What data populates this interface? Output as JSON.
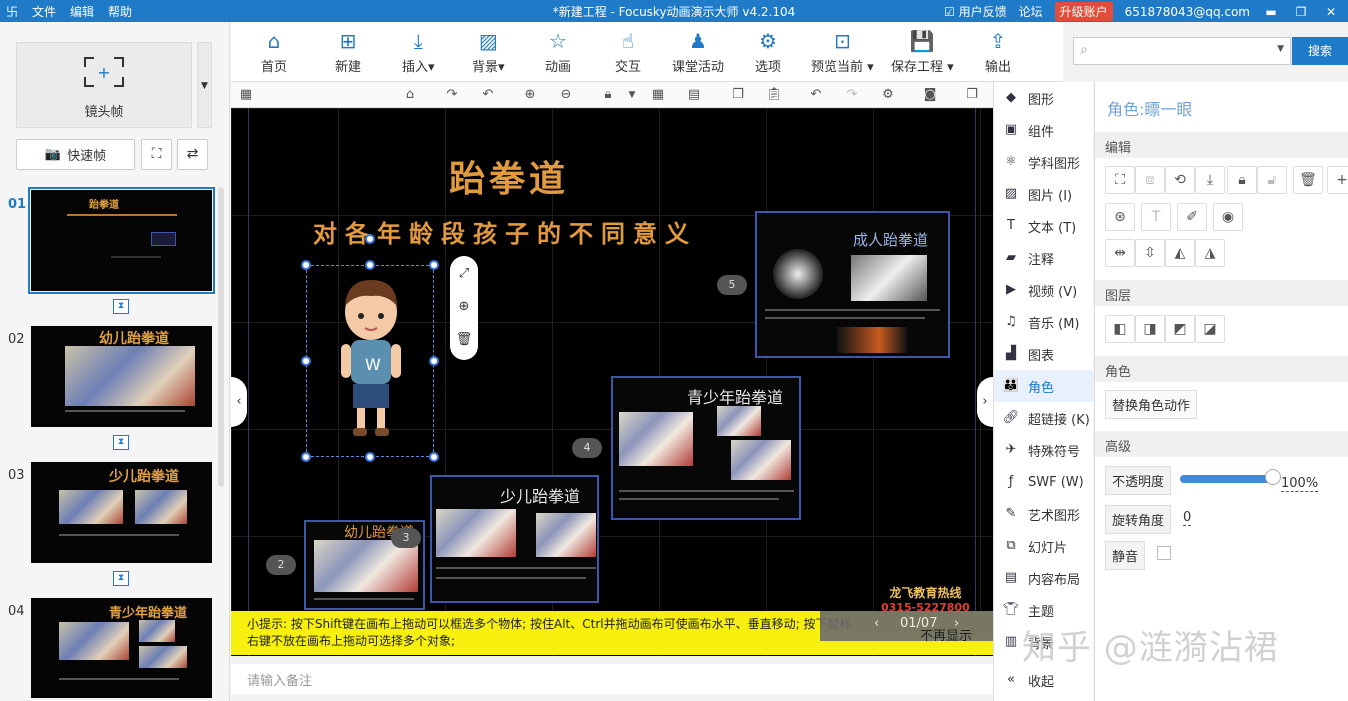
{
  "titlebar": {
    "menu": [
      "文件",
      "编辑",
      "帮助"
    ],
    "title": "*新建工程 - Focusky动画演示大师  v4.2.104",
    "feedback": "用户反馈",
    "forum": "论坛",
    "upgrade": "升级账户",
    "account": "651878043@qq.com",
    "brand_color": "#1f7ac7"
  },
  "left": {
    "camera_frame": "镜头帧",
    "snapshot": "快速帧",
    "slides": [
      {
        "num": "01",
        "title": "跆拳道"
      },
      {
        "num": "02",
        "title": "幼儿跆拳道"
      },
      {
        "num": "03",
        "title": "少儿跆拳道"
      },
      {
        "num": "04",
        "title": "青少年跆拳道"
      }
    ]
  },
  "toolbar": [
    {
      "label": "首页",
      "icon": "home-icon"
    },
    {
      "label": "新建",
      "icon": "new-icon"
    },
    {
      "label": "插入",
      "icon": "insert-icon"
    },
    {
      "label": "背景",
      "icon": "background-icon"
    },
    {
      "label": "动画",
      "icon": "animation-icon"
    },
    {
      "label": "交互",
      "icon": "interaction-icon"
    },
    {
      "label": "课堂活动",
      "icon": "classroom-icon"
    },
    {
      "label": "选项",
      "icon": "settings-icon"
    },
    {
      "label": "预览当前",
      "icon": "preview-icon"
    },
    {
      "label": "保存工程",
      "icon": "save-icon"
    },
    {
      "label": "输出",
      "icon": "export-icon"
    }
  ],
  "search": {
    "button": "搜索"
  },
  "canvas": {
    "title": "跆拳道",
    "subtitle": "对各年龄段孩子的不同意义",
    "frames": {
      "adult": "成人跆拳道",
      "teen": "青少年跆拳道",
      "child": "少儿跆拳道",
      "kid": "幼儿跆拳道"
    },
    "badges": [
      "5",
      "4",
      "3",
      "2"
    ],
    "hotline": "龙飞教育热线",
    "phone": "0315-5227800"
  },
  "hint": {
    "text": "小提示: 按下Shift键在画布上拖动可以框选多个物体; 按住Alt、Ctrl并拖动画布可使画布水平、垂直移动; 按下鼠标右键不放在画布上拖动可选择多个对象;",
    "dismiss": "不再显示"
  },
  "pager": {
    "page": "01/07"
  },
  "notes_placeholder": "请输入备注",
  "insert_panel": [
    {
      "label": "图形",
      "icon": "shape-icon"
    },
    {
      "label": "组件",
      "icon": "component-icon"
    },
    {
      "label": "学科图形",
      "icon": "subject-shape-icon"
    },
    {
      "label": "图片 (I)",
      "icon": "image-icon"
    },
    {
      "label": "文本 (T)",
      "icon": "text-icon"
    },
    {
      "label": "注释",
      "icon": "note-icon"
    },
    {
      "label": "视频 (V)",
      "icon": "video-icon"
    },
    {
      "label": "音乐 (M)",
      "icon": "music-icon"
    },
    {
      "label": "图表",
      "icon": "chart-icon"
    },
    {
      "label": "角色",
      "icon": "character-icon"
    },
    {
      "label": "超链接 (K)",
      "icon": "link-icon"
    },
    {
      "label": "特殊符号",
      "icon": "symbol-icon"
    },
    {
      "label": "SWF (W)",
      "icon": "swf-icon"
    },
    {
      "label": "艺术图形",
      "icon": "art-shape-icon"
    },
    {
      "label": "幻灯片",
      "icon": "slide-icon"
    },
    {
      "label": "内容布局",
      "icon": "layout-icon"
    },
    {
      "label": "主题",
      "icon": "theme-icon"
    },
    {
      "label": "背景",
      "icon": "bg-icon"
    }
  ],
  "collapse": "收起",
  "props": {
    "role_title": "角色:瞟一眼",
    "edit": "编辑",
    "layer": "图层",
    "role": "角色",
    "replace_action": "替换角色动作",
    "advanced": "高级",
    "opacity_label": "不透明度",
    "opacity_value": "100%",
    "rotation_label": "旋转角度",
    "rotation_value": "0",
    "mute_label": "静音"
  },
  "watermark": "知乎 @涟漪沾裙"
}
